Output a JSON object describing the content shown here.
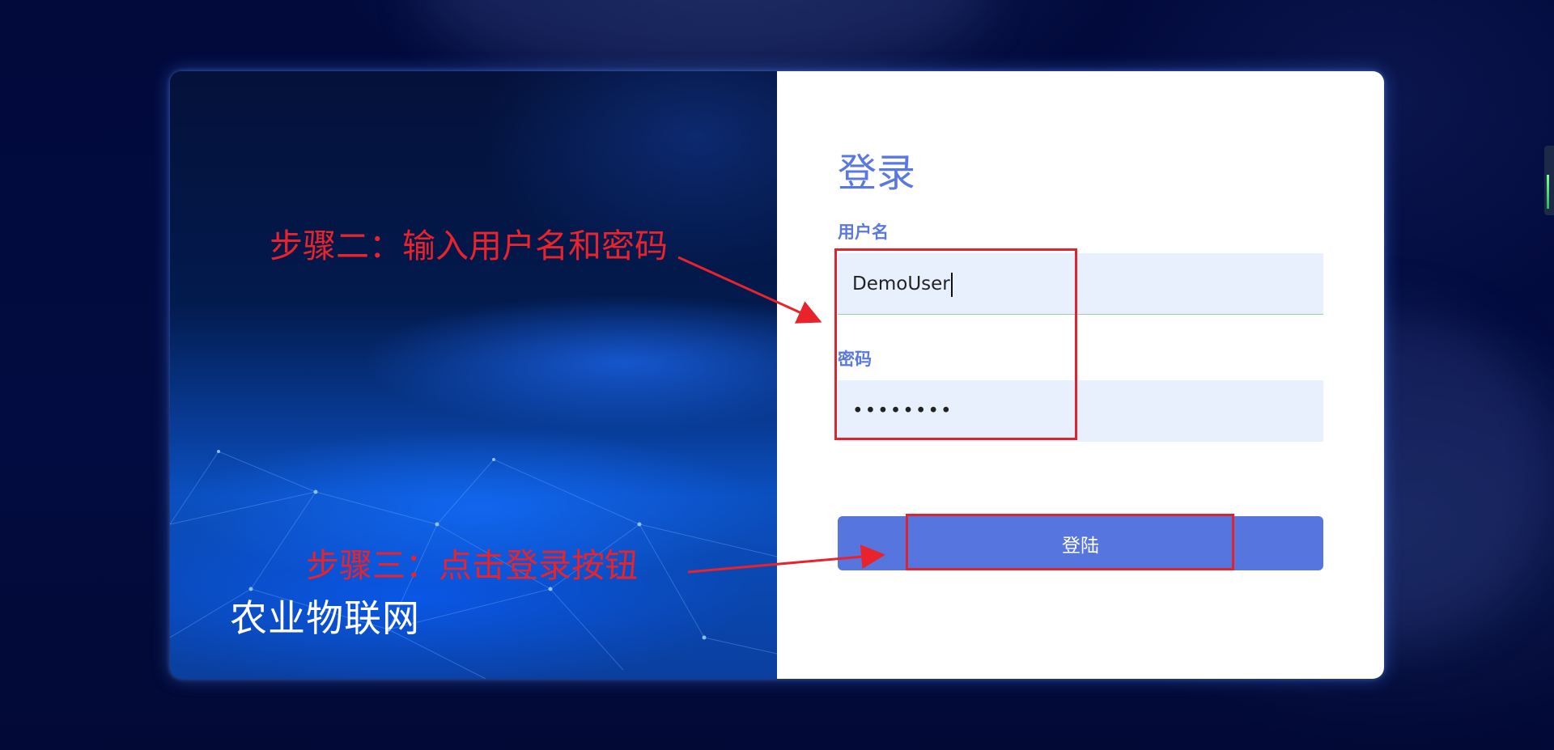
{
  "brand": {
    "name": "农业物联网"
  },
  "login": {
    "title": "登录",
    "username_label": "用户名",
    "username_value": "DemoUser",
    "password_label": "密码",
    "password_value": "••••••••",
    "submit_label": "登陆"
  },
  "annotations": {
    "step2": "步骤二：输入用户名和密码",
    "step3": "步骤三：点击登录按钮",
    "color": "#e8232b"
  },
  "colors": {
    "accent": "#5675df",
    "title": "#5a78dd",
    "input_bg": "#e8f0fe",
    "page_bg": "#030c40"
  }
}
